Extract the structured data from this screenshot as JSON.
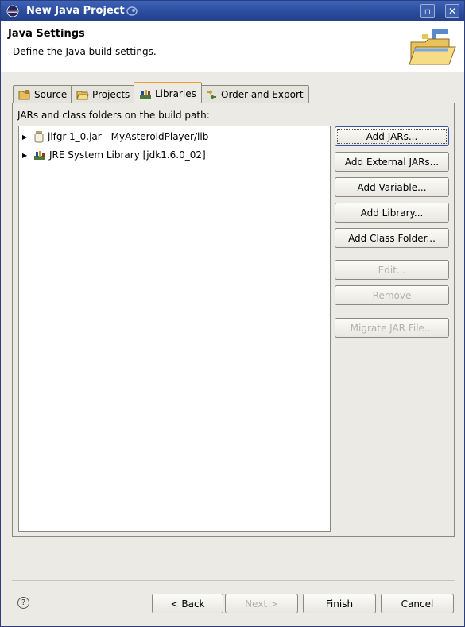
{
  "window": {
    "title": "New Java Project"
  },
  "header": {
    "title": "Java Settings",
    "description": "Define the Java build settings."
  },
  "tabs": [
    {
      "label": "Source",
      "icon": "source-folder-icon",
      "active": false
    },
    {
      "label": "Projects",
      "icon": "projects-folder-icon",
      "active": false
    },
    {
      "label": "Libraries",
      "icon": "libraries-icon",
      "active": true
    },
    {
      "label": "Order and Export",
      "icon": "order-export-icon",
      "active": false
    }
  ],
  "panel": {
    "label": "JARs and class folders on the build path:",
    "tree": [
      {
        "label": "jlfgr-1_0.jar - MyAsteroidPlayer/lib",
        "icon": "jar-icon"
      },
      {
        "label": "JRE System Library [jdk1.6.0_02]",
        "icon": "library-icon"
      }
    ],
    "buttons": [
      {
        "label": "Add JARs...",
        "enabled": true
      },
      {
        "label": "Add External JARs...",
        "enabled": true
      },
      {
        "label": "Add Variable...",
        "enabled": true
      },
      {
        "label": "Add Library...",
        "enabled": true
      },
      {
        "label": "Add Class Folder...",
        "enabled": true
      },
      {
        "label": "Edit...",
        "enabled": false
      },
      {
        "label": "Remove",
        "enabled": false
      },
      {
        "label": "Migrate JAR File...",
        "enabled": false
      }
    ]
  },
  "footer": {
    "help": "?",
    "back": "< Back",
    "next": "Next >",
    "finish": "Finish",
    "cancel": "Cancel"
  }
}
